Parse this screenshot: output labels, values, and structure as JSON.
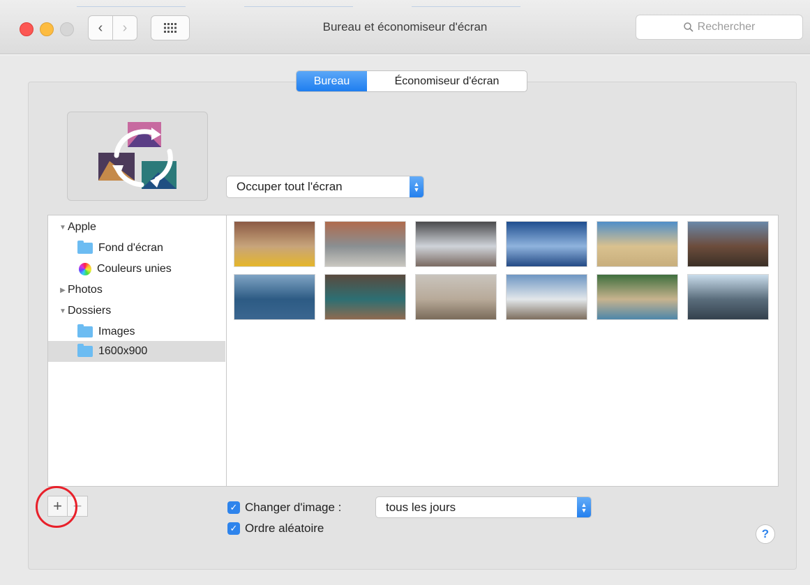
{
  "window": {
    "title": "Bureau et économiseur d'écran"
  },
  "toolbar": {
    "search_placeholder": "Rechercher"
  },
  "tabs": [
    {
      "label": "Bureau",
      "selected": true
    },
    {
      "label": "Économiseur d'écran",
      "selected": false
    }
  ],
  "fit_popup": {
    "value": "Occuper tout l'écran"
  },
  "sidebar": {
    "items": [
      {
        "label": "Apple",
        "kind": "group",
        "disclosure": "▼"
      },
      {
        "label": "Fond d'écran",
        "kind": "folder"
      },
      {
        "label": "Couleurs unies",
        "kind": "color-wheel"
      },
      {
        "label": "Photos",
        "kind": "group",
        "disclosure": "▶"
      },
      {
        "label": "Dossiers",
        "kind": "group",
        "disclosure": "▼"
      },
      {
        "label": "Images",
        "kind": "folder"
      },
      {
        "label": "1600x900",
        "kind": "folder",
        "selected": true
      }
    ]
  },
  "thumbnails": [
    {
      "name": "taxi-street",
      "colors": [
        "#8b5a44",
        "#c7a47b",
        "#e5b62a"
      ]
    },
    {
      "name": "rooftop-pool",
      "colors": [
        "#b06b4d",
        "#8a8f92",
        "#c9c7c0"
      ]
    },
    {
      "name": "snowy-trees",
      "colors": [
        "#4a4a4c",
        "#cfd3d9",
        "#7a6a62"
      ]
    },
    {
      "name": "ice-floes",
      "colors": [
        "#1f4e8f",
        "#8fb3dd",
        "#244a85"
      ]
    },
    {
      "name": "sandy-beach",
      "colors": [
        "#4f8ec8",
        "#d9c18f",
        "#c8ae7c"
      ]
    },
    {
      "name": "old-building",
      "colors": [
        "#6a88a8",
        "#6c4c3c",
        "#3b3026"
      ]
    },
    {
      "name": "misty-lake",
      "colors": [
        "#7fa4c4",
        "#2d5b84",
        "#3a6690"
      ]
    },
    {
      "name": "venice-canal",
      "colors": [
        "#5a4a3e",
        "#2d6f73",
        "#8f6a50"
      ]
    },
    {
      "name": "foggy-beach",
      "colors": [
        "#c9c4bd",
        "#b8aa99",
        "#7a6b5a"
      ]
    },
    {
      "name": "rocky-coast",
      "colors": [
        "#6e96c3",
        "#e2e7ea",
        "#7d6e5e"
      ]
    },
    {
      "name": "cliff-shore",
      "colors": [
        "#3f6f3e",
        "#c7b38e",
        "#4e87a9"
      ]
    },
    {
      "name": "statue-sky",
      "colors": [
        "#c9dceb",
        "#5a6d7c",
        "#34414d"
      ]
    }
  ],
  "buttons": {
    "add": "+",
    "remove": "−"
  },
  "change_picture": {
    "label": "Changer d'image :",
    "checked": true,
    "interval": "tous les jours"
  },
  "random_order": {
    "label": "Ordre aléatoire",
    "checked": true
  },
  "help": {
    "label": "?"
  }
}
